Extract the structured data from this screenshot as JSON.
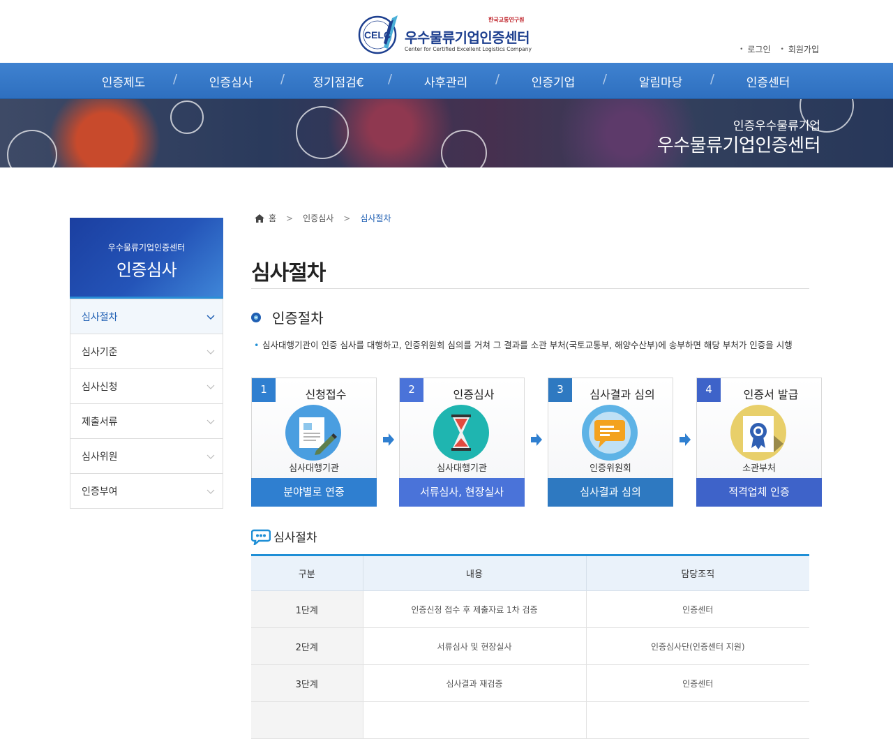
{
  "header": {
    "logo_badge": "CELC",
    "logo_badge_ring": "인증우수물류기업",
    "logo_org": "한국교통연구원",
    "logo_title": "우수물류기업인증센터",
    "logo_subtitle": "Center for Certified Excellent Logistics Company",
    "links": [
      "로그인",
      "회원가입"
    ]
  },
  "nav": {
    "items": [
      "인증제도",
      "인증심사",
      "정기점검€",
      "사후관리",
      "인증기업",
      "알림마당",
      "인증센터"
    ]
  },
  "banner": {
    "line1": "인증우수물류기업",
    "line2": "우수물류기업인증센터"
  },
  "lnb": {
    "subtitle": "우수물류기업인증센터",
    "title": "인증심사",
    "items": [
      "심사절차",
      "심사기준",
      "심사신청",
      "제출서류",
      "심사위원",
      "인증부여"
    ]
  },
  "breadcrumb": {
    "home": "홈",
    "level1": "인증심사",
    "current": "심사절차"
  },
  "page": {
    "title": "심사절차",
    "section_title": "인증절차",
    "note": "심사대행기관이 인증 심사를 대행하고, 인증위원회 심의를 거쳐 그 결과를 소관 부처(국토교통부, 해양수산부)에 송부하면 해당 부처가 인증을 시행",
    "sub_title": "심사절차"
  },
  "steps": [
    {
      "num": "1",
      "title": "신청접수",
      "role": "심사대행기관",
      "action": "분야별로 연중",
      "icon": "document-pen-icon",
      "color": "#2f7fd0"
    },
    {
      "num": "2",
      "title": "인증심사",
      "role": "심사대행기관",
      "action": "서류심사, 현장실사",
      "icon": "hourglass-icon",
      "color": "#4a73d9"
    },
    {
      "num": "3",
      "title": "심사결과 심의",
      "role": "인증위원회",
      "action": "심사결과 심의",
      "icon": "speech-bubble-icon",
      "color": "#2e79c1"
    },
    {
      "num": "4",
      "title": "인증서 발급",
      "role": "소관부처",
      "action": "적격업체 인증",
      "icon": "certificate-ribbon-icon",
      "color": "#3e63c9"
    }
  ],
  "table": {
    "headers": [
      "구분",
      "내용",
      "담당조직"
    ],
    "rows": [
      [
        "1단계",
        "인증신청 접수 후 제출자료 1차 검증",
        "인증센터"
      ],
      [
        "2단계",
        "서류심사 및 현장실사",
        "인증심사단(인증센터 지원)"
      ],
      [
        "3단계",
        "심사결과 재검증",
        "인증센터"
      ]
    ]
  }
}
